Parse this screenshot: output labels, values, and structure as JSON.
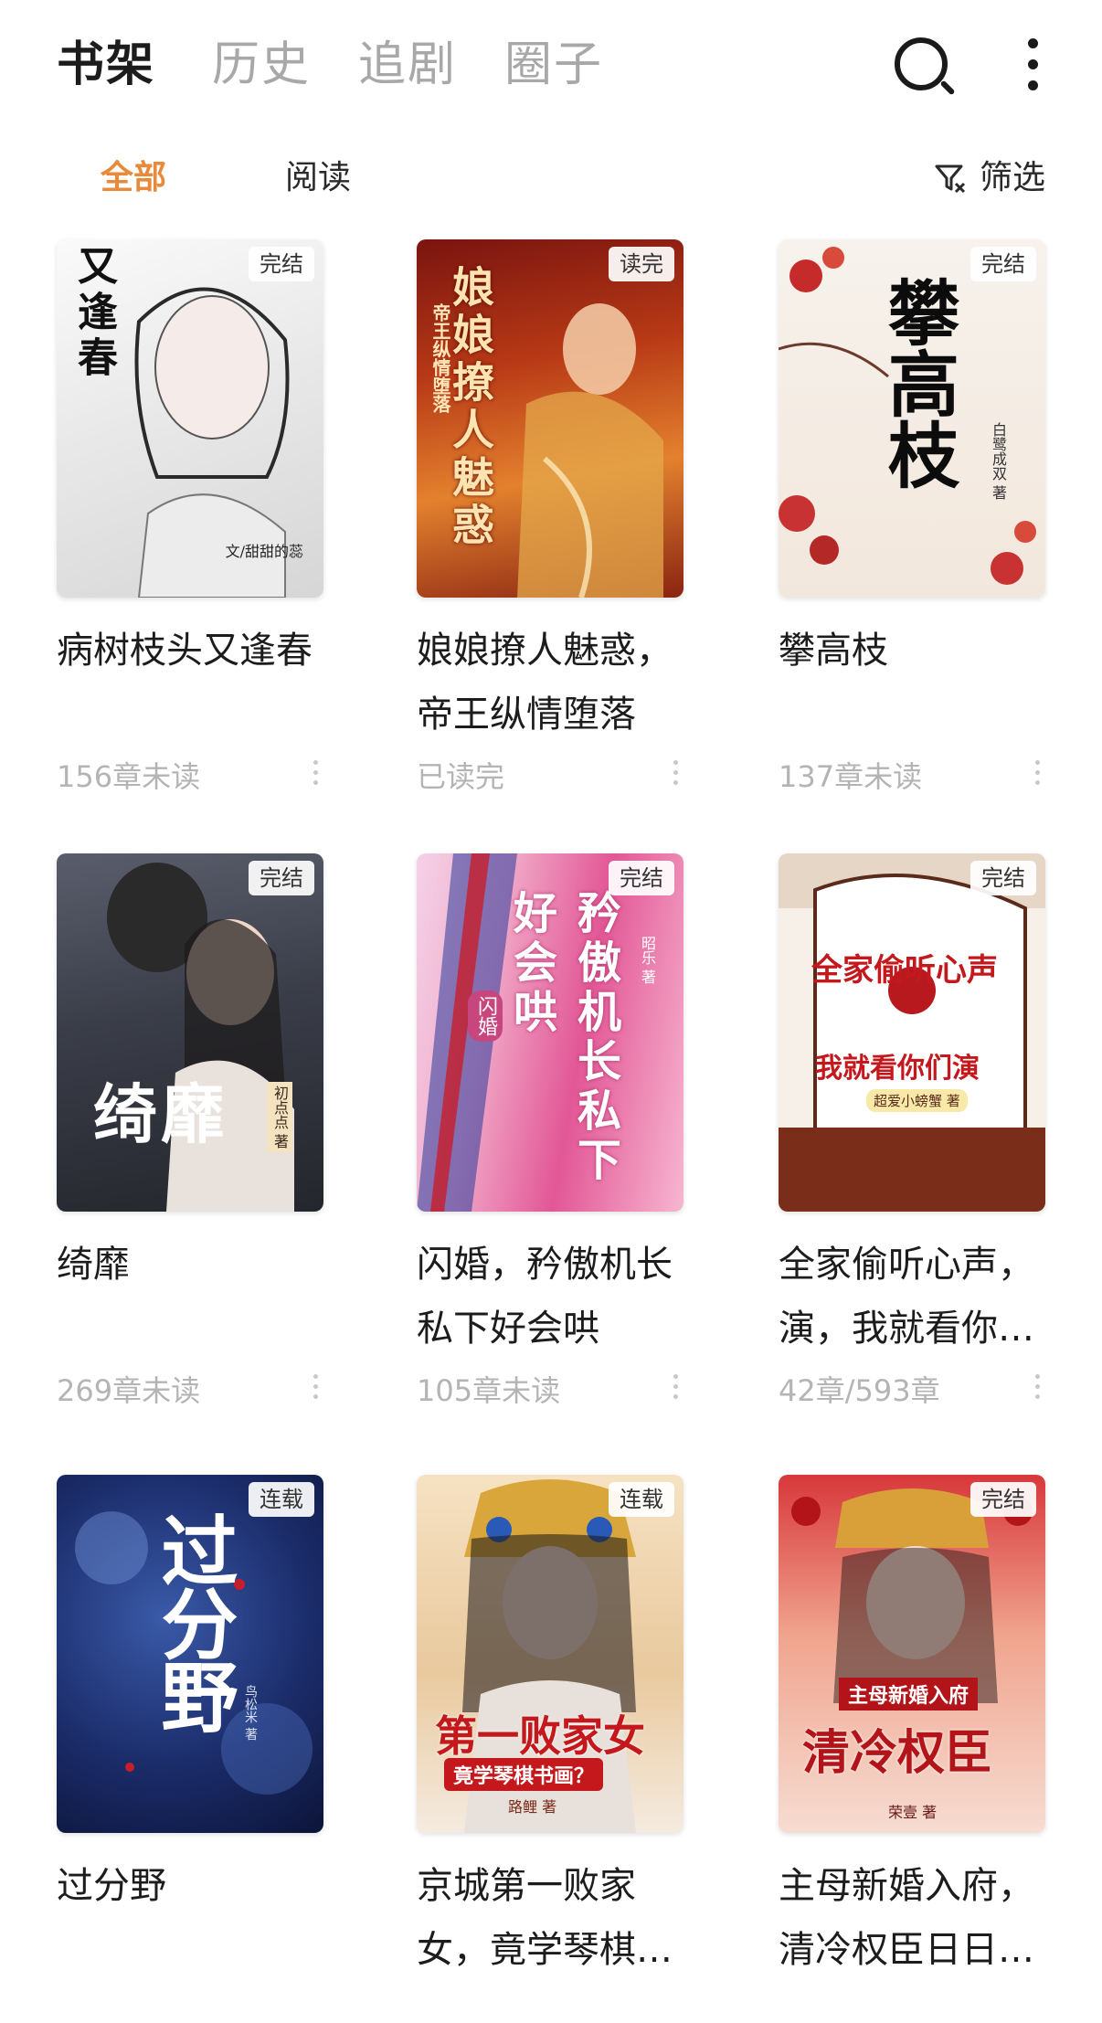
{
  "top_tabs": [
    {
      "label": "书架",
      "active": true
    },
    {
      "label": "历史",
      "active": false
    },
    {
      "label": "追剧",
      "active": false
    },
    {
      "label": "圈子",
      "active": false
    }
  ],
  "header_icons": [
    "search-icon",
    "more-vertical-icon"
  ],
  "sub_tabs": [
    {
      "label": "全部",
      "active": true
    },
    {
      "label": "阅读",
      "active": false
    }
  ],
  "filter_label": "筛选",
  "accent_color": "#e98a3a",
  "books": [
    {
      "title": "病树枝头又逢春",
      "status": "156章未读",
      "badge": "完结",
      "cover_text": "又逢春",
      "cover_author": "文/甜甜的蕊"
    },
    {
      "title": "娘娘撩人魅惑，帝王纵情堕落",
      "status": "已读完",
      "badge": "读完",
      "cover_text": "娘娘撩人魅惑",
      "cover_sub": "帝王纵情堕落"
    },
    {
      "title": "攀高枝",
      "status": "137章未读",
      "badge": "完结",
      "cover_text": "攀高枝",
      "cover_author": "白鹭成双 著"
    },
    {
      "title": "绮靡",
      "status": "269章未读",
      "badge": "完结",
      "cover_text": "绮靡",
      "cover_author": "初点点 著"
    },
    {
      "title": "闪婚，矜傲机长私下好会哄",
      "status": "105章未读",
      "badge": "完结",
      "cover_text": "矜傲机长私下好会哄",
      "cover_sub": "闪婚",
      "cover_author": "昭乐 著"
    },
    {
      "title": "全家偷听心声，演，我就看你们演",
      "status": "42章/593章",
      "badge": "完结",
      "cover_text": "全家偷听心声",
      "cover_sub": "我就看你们演",
      "cover_author": "超爱小螃蟹 著"
    },
    {
      "title": "过分野",
      "status": "",
      "badge": "连载",
      "cover_text": "过分野",
      "cover_author": "鸟松米 著"
    },
    {
      "title": "京城第一败家女，竟学琴棋书画？",
      "status": "",
      "badge": "连载",
      "cover_text": "第一败家女",
      "cover_sub": "竟学琴棋书画？",
      "cover_author": "路鲤 著"
    },
    {
      "title": "主母新婚入府，清冷权臣日日沦陷",
      "status": "",
      "badge": "完结",
      "cover_text": "清冷权臣",
      "cover_sub": "主母新婚入府",
      "cover_author": "荣壹 著"
    }
  ]
}
